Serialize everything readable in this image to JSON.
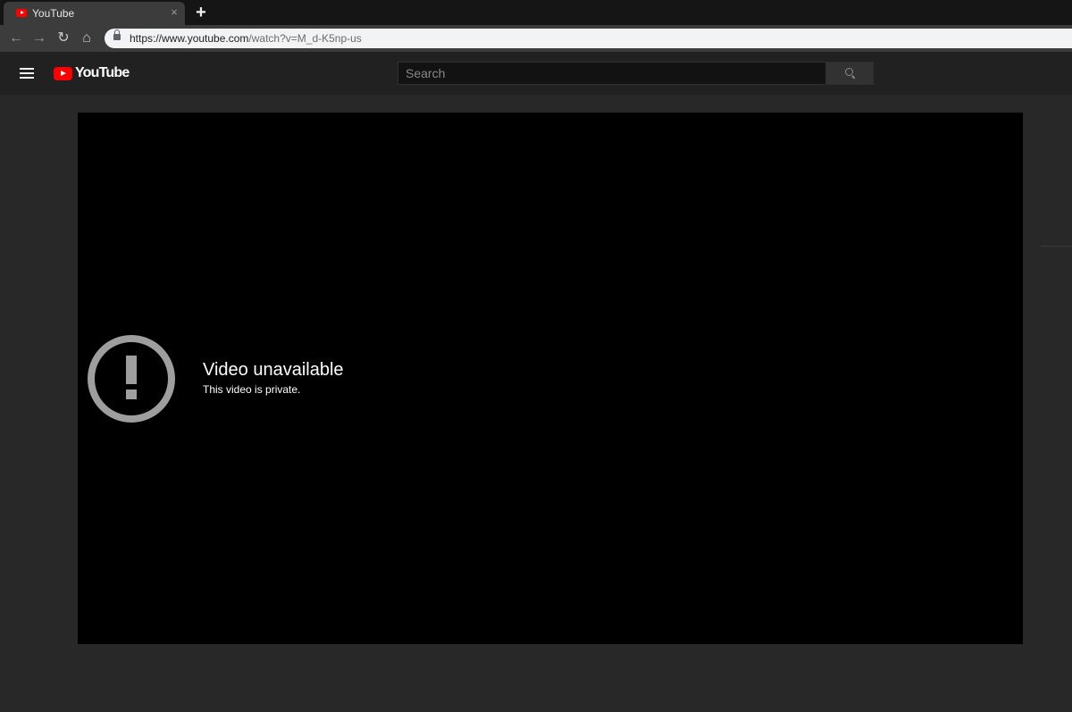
{
  "browser": {
    "tab": {
      "title": "YouTube",
      "close_glyph": "×"
    },
    "new_tab_glyph": "+",
    "nav": {
      "back": "←",
      "forward": "→",
      "reload": "↻",
      "home": "⌂"
    },
    "url": {
      "host_part": "https://www.youtube.com",
      "rest_part": "/watch?v=M_d-K5np-us"
    }
  },
  "masthead": {
    "logo_text": "YouTube",
    "search": {
      "placeholder": "Search",
      "value": ""
    }
  },
  "player": {
    "error_title": "Video unavailable",
    "error_subtitle": "This video is private."
  },
  "icons": {
    "menu": "hamburger-icon",
    "search": "search-icon",
    "error": "exclamation-circle-icon",
    "lock": "lock-icon"
  },
  "colors": {
    "brand_red": "#ff0000",
    "page_bg": "#282828",
    "masthead_bg": "#212121",
    "player_bg": "#000000",
    "error_icon": "#9e9e9e"
  }
}
